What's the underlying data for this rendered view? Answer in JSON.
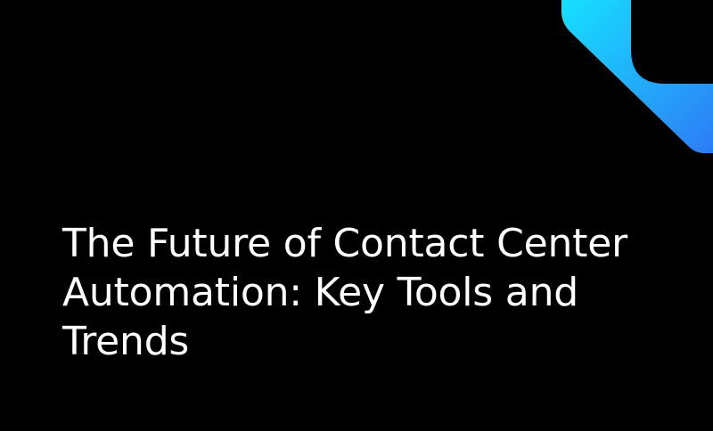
{
  "title": "The Future of Contact Center Automation: Key Tools and Trends",
  "decor": {
    "gradient_start": "#16e0ff",
    "gradient_end": "#2d7cf6",
    "background": "#000000"
  }
}
